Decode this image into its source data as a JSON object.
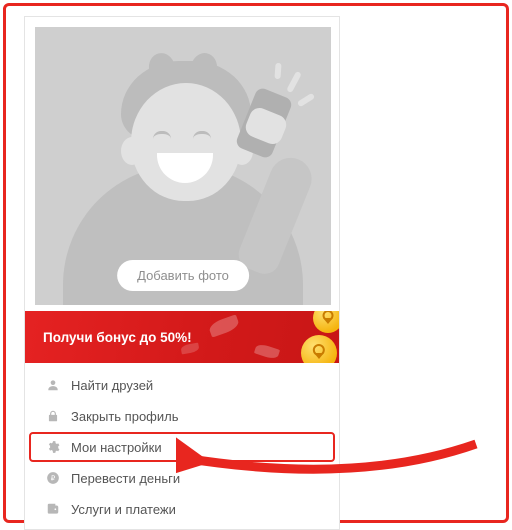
{
  "avatar": {
    "add_photo_label": "Добавить фото"
  },
  "bonus": {
    "text": "Получи бонус до 50%!"
  },
  "menu": {
    "items": [
      {
        "icon": "person-icon",
        "label": "Найти друзей"
      },
      {
        "icon": "lock-icon",
        "label": "Закрыть профиль"
      },
      {
        "icon": "gear-icon",
        "label": "Мои настройки"
      },
      {
        "icon": "ruble-icon",
        "label": "Перевести деньги"
      },
      {
        "icon": "wallet-icon",
        "label": "Услуги и платежи"
      }
    ]
  }
}
